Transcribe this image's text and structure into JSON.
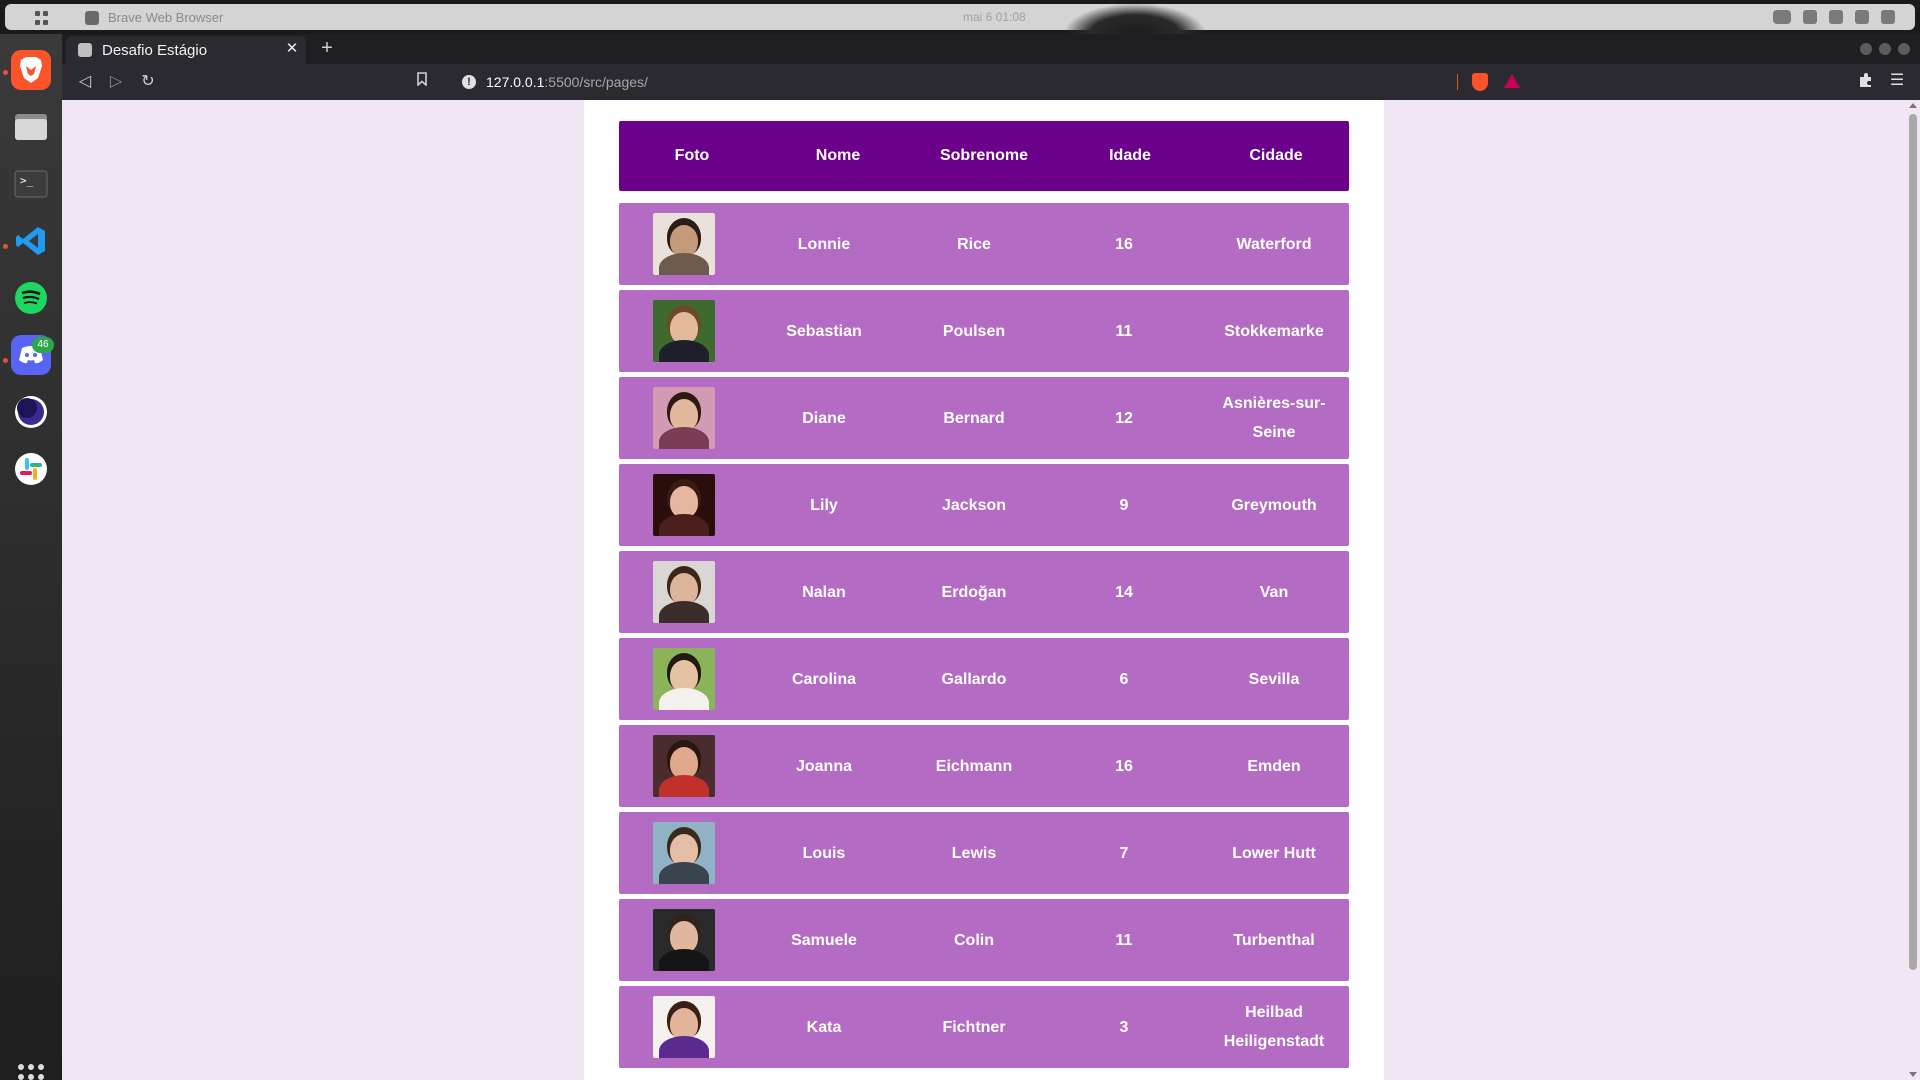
{
  "system": {
    "app_title": "Brave Web Browser",
    "clock": "mai 6  01:08",
    "dock_badge": "46"
  },
  "browser": {
    "tab_title": "Desafio Estágio",
    "close_label": "✕",
    "new_tab_label": "+",
    "url_host": "127.0.0.1",
    "url_path": ":5500/src/pages/",
    "back": "◁",
    "forward": "▷",
    "reload": "↻",
    "bookmark": "🔖",
    "extensions": "✚",
    "menu": "☰"
  },
  "table": {
    "headers": [
      "Foto",
      "Nome",
      "Sobrenome",
      "Idade",
      "Cidade"
    ],
    "rows": [
      {
        "first": "Lonnie",
        "last": "Rice",
        "age": "16",
        "city": "Waterford",
        "skin": "#c49a7a",
        "hair": "#2a1d16",
        "shirt": "#6f5a4e",
        "bg": "#e9e1da"
      },
      {
        "first": "Sebastian",
        "last": "Poulsen",
        "age": "11",
        "city": "Stokkemarke",
        "skin": "#e2b99a",
        "hair": "#6b4a2b",
        "shirt": "#1d1f2b",
        "bg": "#3d6b2e"
      },
      {
        "first": "Diane",
        "last": "Bernard",
        "age": "12",
        "city": "Asnières-sur-Seine",
        "skin": "#e1b79d",
        "hair": "#2d1a12",
        "shirt": "#7a3b54",
        "bg": "#d39ab3"
      },
      {
        "first": "Lily",
        "last": "Jackson",
        "age": "9",
        "city": "Greymouth",
        "skin": "#e4b8a0",
        "hair": "#3a1a12",
        "shirt": "#4a1e1a",
        "bg": "#2a0e0c"
      },
      {
        "first": "Nalan",
        "last": "Erdoğan",
        "age": "14",
        "city": "Van",
        "skin": "#dcb49a",
        "hair": "#3b2418",
        "shirt": "#3a2d2a",
        "bg": "#d9d7d4"
      },
      {
        "first": "Carolina",
        "last": "Gallardo",
        "age": "6",
        "city": "Sevilla",
        "skin": "#e5c2a4",
        "hair": "#241812",
        "shirt": "#f4f0ec",
        "bg": "#8ab35a"
      },
      {
        "first": "Joanna",
        "last": "Eichmann",
        "age": "16",
        "city": "Emden",
        "skin": "#e0a98c",
        "hair": "#2a150f",
        "shirt": "#c0312b",
        "bg": "#4a2b2e"
      },
      {
        "first": "Louis",
        "last": "Lewis",
        "age": "7",
        "city": "Lower Hutt",
        "skin": "#e4bea6",
        "hair": "#3a2a1e",
        "shirt": "#39444f",
        "bg": "#8fb3c4"
      },
      {
        "first": "Samuele",
        "last": "Colin",
        "age": "11",
        "city": "Turbenthal",
        "skin": "#e0b69c",
        "hair": "#2f241c",
        "shirt": "#151515",
        "bg": "#2a2a2a"
      },
      {
        "first": "Kata",
        "last": "Fichtner",
        "age": "3",
        "city": "Heilbad Heiligenstadt",
        "skin": "#e2b59a",
        "hair": "#3a1f15",
        "shirt": "#5a2a8f",
        "bg": "#f4f1ee"
      }
    ]
  }
}
